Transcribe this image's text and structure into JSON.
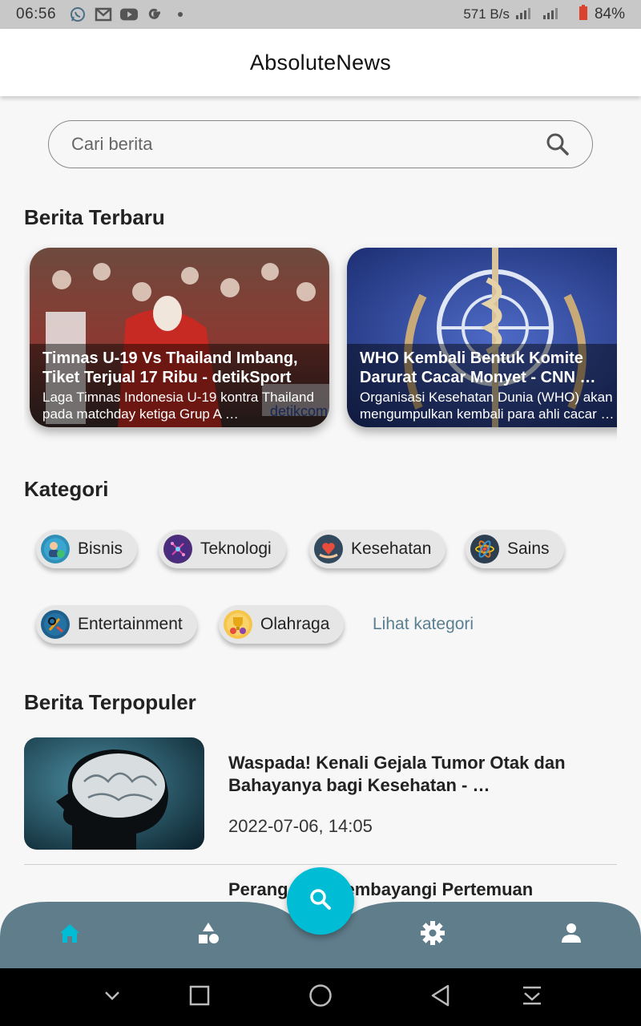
{
  "status_bar": {
    "time": "06:56",
    "net_speed": "571 B/s",
    "battery": "84%",
    "icons": [
      "whatsapp-icon",
      "gmail-icon",
      "youtube-icon",
      "google-icon",
      "dot-icon"
    ]
  },
  "app": {
    "title": "AbsoluteNews"
  },
  "search": {
    "placeholder": "Cari berita"
  },
  "latest": {
    "heading": "Berita Terbaru",
    "cards": [
      {
        "title": "Timnas U-19 Vs Thailand Imbang, Tiket Terjual 17 Ribu - detikSport",
        "desc": "Laga Timnas Indonesia U-19 kontra Thailand pada matchday ketiga Grup A …",
        "watermark": "detikcom"
      },
      {
        "title": "WHO Kembali Bentuk Komite Darurat Cacar Monyet - CNN …",
        "desc": "Organisasi Kesehatan Dunia (WHO) akan mengumpulkan kembali para ahli cacar …"
      }
    ]
  },
  "categories": {
    "heading": "Kategori",
    "items": [
      {
        "label": "Bisnis",
        "icon": "business-icon"
      },
      {
        "label": "Teknologi",
        "icon": "technology-icon"
      },
      {
        "label": "Kesehatan",
        "icon": "health-icon"
      },
      {
        "label": "Sains",
        "icon": "science-icon"
      },
      {
        "label": "Entertainment",
        "icon": "entertainment-icon"
      },
      {
        "label": "Olahraga",
        "icon": "sports-icon"
      }
    ],
    "more": "Lihat kategori"
  },
  "popular": {
    "heading": "Berita Terpopuler",
    "items": [
      {
        "title": "Waspada! Kenali Gejala Tumor Otak dan Bahayanya bagi Kesehatan - …",
        "date": "2022-07-06, 14:05"
      },
      {
        "title": "Perang … a Membayangi Pertemuan"
      }
    ]
  },
  "colors": {
    "accent": "#00bcd4",
    "nav_bar": "#607d8b",
    "link": "#5a7f92"
  }
}
